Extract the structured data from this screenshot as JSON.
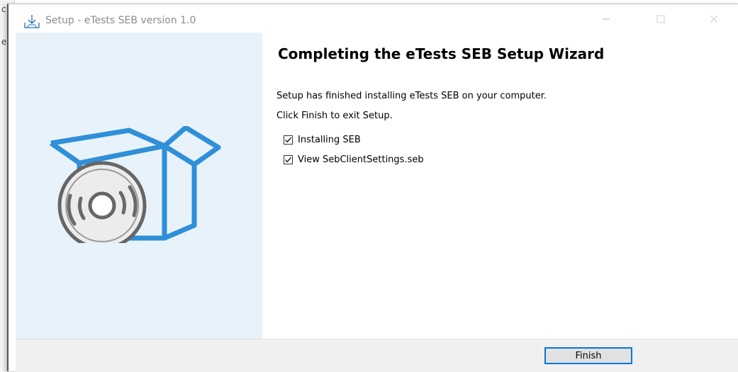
{
  "window": {
    "title": "Setup - eTests SEB version 1.0",
    "controls": {
      "minimize_icon": "minimize-icon",
      "maximize_icon": "maximize-icon",
      "close_icon": "close-icon"
    }
  },
  "background_fragments": [
    "c",
    "e"
  ],
  "sidebar": {
    "artwork_icon": "software-box-with-disc-icon",
    "background_color": "#e8f2fa",
    "accent_color": "#2f8fd8"
  },
  "content": {
    "heading": "Completing the eTests SEB Setup Wizard",
    "line1": "Setup has finished installing eTests SEB on your computer.",
    "line2": "Click Finish to exit Setup.",
    "options": [
      {
        "label": "Installing SEB",
        "checked": true
      },
      {
        "label": "View SebClientSettings.seb",
        "checked": true
      }
    ]
  },
  "footer": {
    "finish_label": "Finish",
    "focus_color": "#0078d7"
  }
}
